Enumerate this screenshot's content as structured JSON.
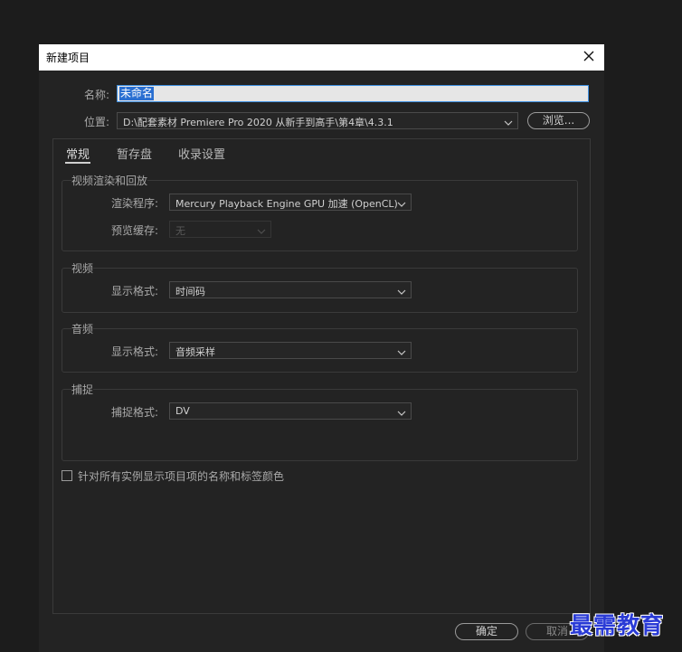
{
  "dialog": {
    "title": "新建项目",
    "close_icon": "close-icon"
  },
  "name": {
    "label": "名称:",
    "value": "未命名"
  },
  "location": {
    "label": "位置:",
    "value": "D:\\配套素材 Premiere Pro 2020 从新手到高手\\第4章\\4.3.1",
    "browse_label": "浏览..."
  },
  "tabs": [
    {
      "label": "常规",
      "active": true
    },
    {
      "label": "暂存盘",
      "active": false
    },
    {
      "label": "收录设置",
      "active": false
    }
  ],
  "video_render": {
    "title": "视频渲染和回放",
    "renderer_label": "渲染程序:",
    "renderer_value": "Mercury Playback Engine GPU 加速 (OpenCL)",
    "preview_cache_label": "预览缓存:",
    "preview_cache_value": "无"
  },
  "video": {
    "title": "视频",
    "display_format_label": "显示格式:",
    "display_format_value": "时间码"
  },
  "audio": {
    "title": "音频",
    "display_format_label": "显示格式:",
    "display_format_value": "音频采样"
  },
  "capture": {
    "title": "捕捉",
    "capture_format_label": "捕捉格式:",
    "capture_format_value": "DV"
  },
  "show_names_checkbox": {
    "label": "针对所有实例显示项目项的名称和标签颜色",
    "checked": false
  },
  "footer": {
    "ok_label": "确定",
    "cancel_label": "取消"
  },
  "watermark": "最需教育"
}
